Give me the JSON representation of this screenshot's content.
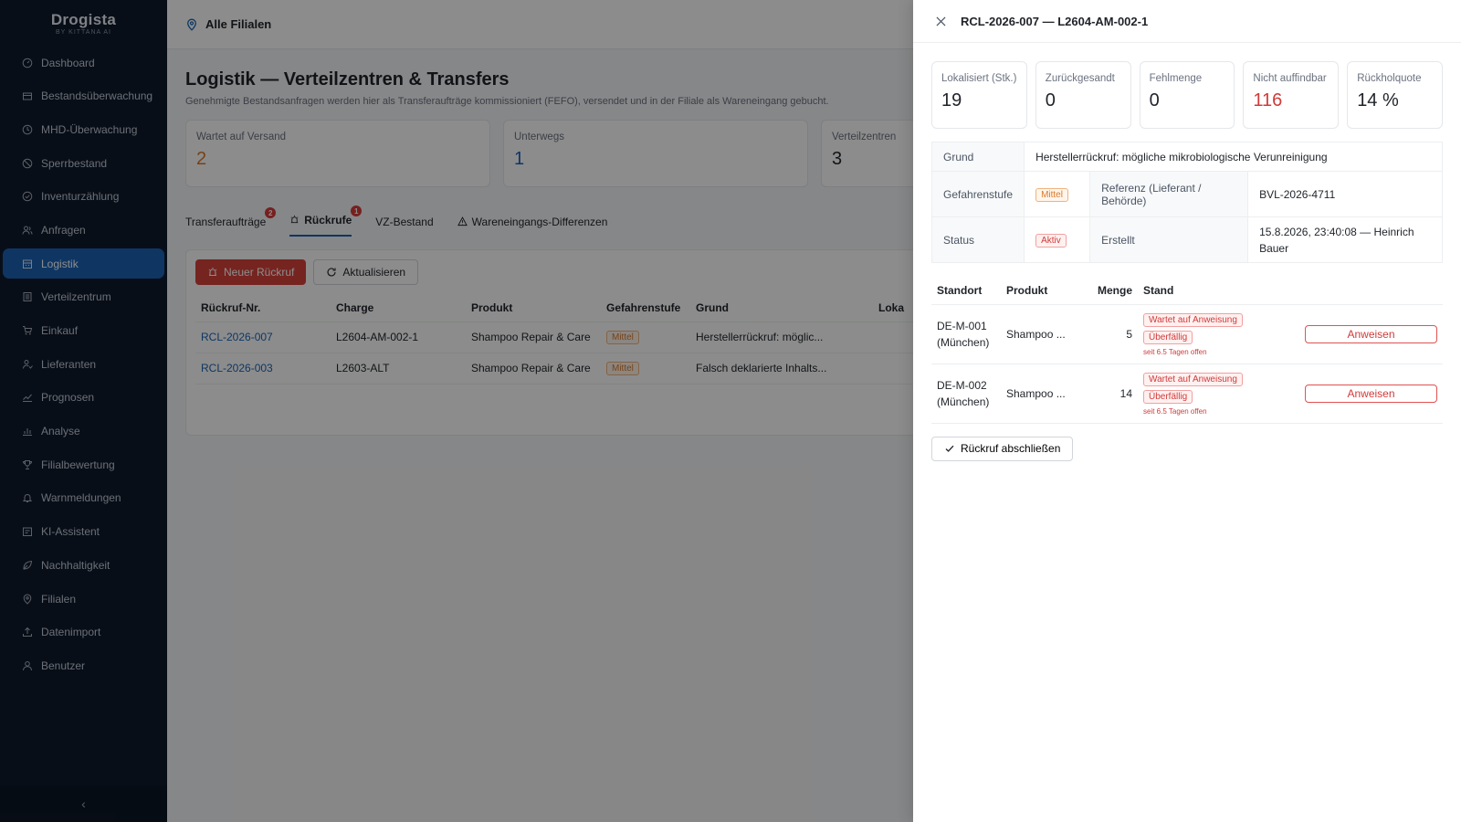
{
  "brand": {
    "name": "Drogista",
    "sub": "BY KITTANA AI"
  },
  "sidebar": {
    "items": [
      {
        "label": "Dashboard",
        "icon": "dashboard-icon"
      },
      {
        "label": "Bestandsüberwachung",
        "icon": "box-icon"
      },
      {
        "label": "MHD-Überwachung",
        "icon": "clock-icon"
      },
      {
        "label": "Sperrbestand",
        "icon": "ban-icon"
      },
      {
        "label": "Inventurzählung",
        "icon": "check-circle-icon"
      },
      {
        "label": "Anfragen",
        "icon": "users-icon"
      },
      {
        "label": "Logistik",
        "icon": "building-icon",
        "active": true
      },
      {
        "label": "Verteilzentrum",
        "icon": "list-icon"
      },
      {
        "label": "Einkauf",
        "icon": "cart-icon"
      },
      {
        "label": "Lieferanten",
        "icon": "supplier-icon"
      },
      {
        "label": "Prognosen",
        "icon": "trend-icon"
      },
      {
        "label": "Analyse",
        "icon": "bar-chart-icon"
      },
      {
        "label": "Filialbewertung",
        "icon": "trophy-icon"
      },
      {
        "label": "Warnmeldungen",
        "icon": "bell-icon"
      },
      {
        "label": "KI-Assistent",
        "icon": "ai-icon"
      },
      {
        "label": "Nachhaltigkeit",
        "icon": "leaf-icon"
      },
      {
        "label": "Filialen",
        "icon": "pin-icon"
      },
      {
        "label": "Datenimport",
        "icon": "upload-icon"
      },
      {
        "label": "Benutzer",
        "icon": "user-icon"
      }
    ],
    "collapse": "‹"
  },
  "topbar": {
    "store": "Alle Filialen"
  },
  "page": {
    "title": "Logistik — Verteilzentren & Transfers",
    "subtitle": "Genehmigte Bestandsanfragen werden hier als Transferaufträge kommissioniert (FEFO), versendet und in der Filiale als Wareneingang gebucht."
  },
  "stats": [
    {
      "label": "Wartet auf Versand",
      "value": "2",
      "color": "#d9792b"
    },
    {
      "label": "Unterwegs",
      "value": "1",
      "color": "#1c63b4"
    },
    {
      "label": "Verteilzentren",
      "value": "3",
      "color": "#1f2329"
    }
  ],
  "tabs": [
    {
      "label": "Transferaufträge",
      "badge": "2"
    },
    {
      "label": "Rückrufe",
      "badge": "1",
      "active": true
    },
    {
      "label": "VZ-Bestand",
      "badge": ""
    },
    {
      "label": "Wareneingangs-Differenzen",
      "badge": ""
    }
  ],
  "toolbar": {
    "new_recall": "Neuer Rückruf",
    "refresh": "Aktualisieren"
  },
  "recall_table": {
    "headers": [
      "Rückruf-Nr.",
      "Charge",
      "Produkt",
      "Gefahrenstufe",
      "Grund",
      "Loka"
    ],
    "rows": [
      {
        "id": "RCL-2026-007",
        "charge": "L2604-AM-002-1",
        "product": "Shampoo Repair & Care",
        "level": "Mittel",
        "reason": "Herstellerrückruf: möglic..."
      },
      {
        "id": "RCL-2026-003",
        "charge": "L2603-ALT",
        "product": "Shampoo Repair & Care",
        "level": "Mittel",
        "reason": "Falsch deklarierte Inhalts..."
      }
    ]
  },
  "drawer": {
    "title": "RCL-2026-007 — L2604-AM-002-1",
    "kpis": [
      {
        "label": "Lokalisiert (Stk.)",
        "value": "19",
        "red": false
      },
      {
        "label": "Zurückgesandt",
        "value": "0",
        "red": false
      },
      {
        "label": "Fehlmenge",
        "value": "0",
        "red": false
      },
      {
        "label": "Nicht auffindbar",
        "value": "116",
        "red": true
      },
      {
        "label": "Rückholquote",
        "value": "14 %",
        "red": false
      }
    ],
    "info": {
      "reason_label": "Grund",
      "reason_value": "Herstellerrückruf: mögliche mikrobiologische Verunreinigung",
      "level_label": "Gefahrenstufe",
      "level_value": "Mittel",
      "ref_label": "Referenz (Lieferant / Behörde)",
      "ref_value": "BVL-2026-4711",
      "status_label": "Status",
      "status_value": "Aktiv",
      "created_label": "Erstellt",
      "created_value": "15.8.2026, 23:40:08 — Heinrich Bauer"
    },
    "locations": {
      "headers": [
        "Standort",
        "Produkt",
        "Menge",
        "Stand"
      ],
      "rows": [
        {
          "location": "DE-M-001 (München)",
          "product": "Shampoo ...",
          "qty": "5",
          "tag1": "Wartet auf Anweisung",
          "tag2": "Überfällig",
          "since": "seit 6.5 Tagen offen",
          "action": "Anweisen"
        },
        {
          "location": "DE-M-002 (München)",
          "product": "Shampoo ...",
          "qty": "14",
          "tag1": "Wartet auf Anweisung",
          "tag2": "Überfällig",
          "since": "seit 6.5 Tagen offen",
          "action": "Anweisen"
        }
      ]
    },
    "close_recall": "Rückruf abschließen"
  }
}
